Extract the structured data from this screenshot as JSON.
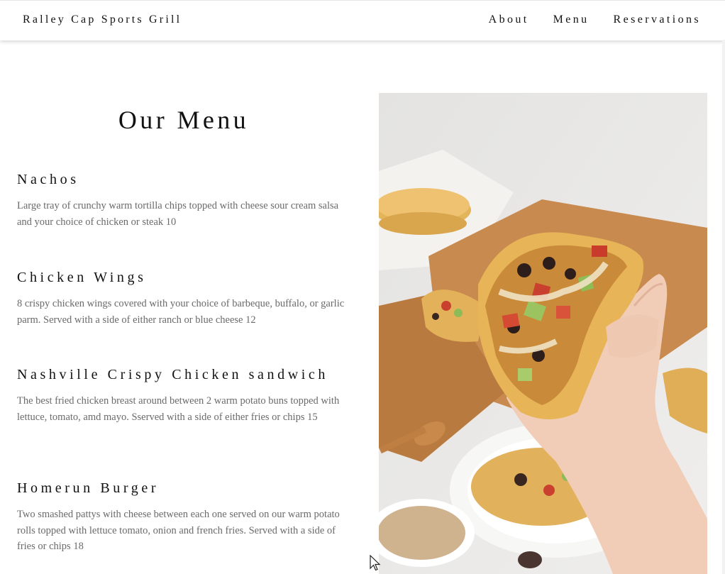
{
  "header": {
    "brand": "Ralley Cap Sports Grill",
    "nav": [
      "About",
      "Menu",
      "Reservations"
    ]
  },
  "menu": {
    "title": "Our Menu",
    "items": [
      {
        "name": "Nachos",
        "description": "Large tray of crunchy warm tortilla chips topped with cheese sour cream salsa and your choice of chicken or steak 10"
      },
      {
        "name": "Chicken Wings",
        "description": "8 crispy chicken wings covered with your choice of barbeque, buffalo, or garlic parm. Served with a side of either ranch or blue cheese 12"
      },
      {
        "name": "Nashville Crispy Chicken sandwich",
        "description": "The best fried chicken breast around between 2 warm potato buns topped with lettuce, tomato, amd mayo. Sserved with a side of either fries or chips 15"
      },
      {
        "name": "Homerun Burger",
        "description": "Two smashed pattys with cheese between each one served on our warm potato rolls topped with lettuce tomato, onion and french fries. Served with a side of fries or chips 18"
      }
    ]
  },
  "image": {
    "subject": "hand-holding-taco-photo"
  }
}
